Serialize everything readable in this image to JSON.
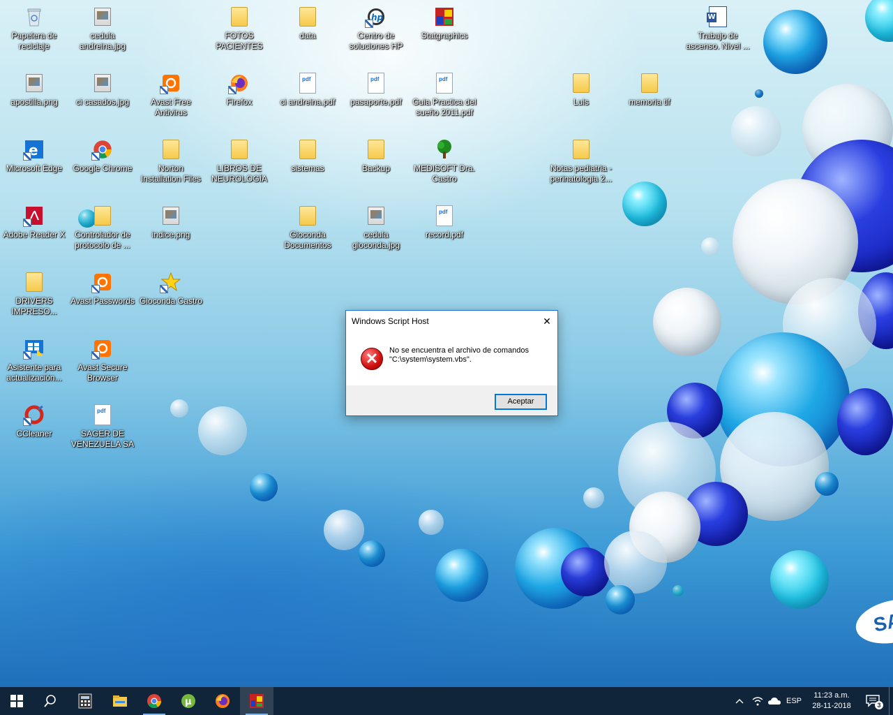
{
  "desktop": {
    "icons": [
      {
        "label": "Papelera de reciclaje",
        "icon": "recycle-bin-icon"
      },
      {
        "label": "cedula andreina.jpg",
        "icon": "image-file-icon"
      },
      {
        "label": "FOTOS PACIENTES",
        "icon": "folder-icon"
      },
      {
        "label": "data",
        "icon": "folder-icon"
      },
      {
        "label": "Centro de soluciones HP",
        "icon": "hp-icon"
      },
      {
        "label": "Statgraphics",
        "icon": "statgraphics-icon"
      },
      {
        "label": "Trabajo de ascenso. Nivel ...",
        "icon": "word-document-icon"
      },
      {
        "label": "apostilla.png",
        "icon": "image-file-icon"
      },
      {
        "label": "ci casados.jpg",
        "icon": "image-file-icon"
      },
      {
        "label": "Avast Free Antivirus",
        "icon": "avast-icon"
      },
      {
        "label": "Firefox",
        "icon": "firefox-icon"
      },
      {
        "label": "ci andreina.pdf",
        "icon": "pdf-file-icon"
      },
      {
        "label": "pasaporte.pdf",
        "icon": "pdf-file-icon"
      },
      {
        "label": "Guia Practica del sueño 2011.pdf",
        "icon": "pdf-file-icon"
      },
      {
        "label": "Luis",
        "icon": "folder-icon"
      },
      {
        "label": "memoria tlf",
        "icon": "folder-icon"
      },
      {
        "label": "Microsoft Edge",
        "icon": "edge-icon"
      },
      {
        "label": "Google Chrome",
        "icon": "chrome-icon"
      },
      {
        "label": "Norton Installation Files",
        "icon": "folder-icon"
      },
      {
        "label": "LIBROS DE NEUROLOGÍA",
        "icon": "folder-icon"
      },
      {
        "label": "sistemas",
        "icon": "folder-icon"
      },
      {
        "label": "Backup",
        "icon": "folder-icon"
      },
      {
        "label": "MEDISOFT Dra. Castro",
        "icon": "tree-icon"
      },
      {
        "label": "Notas pediatria - perinatologia 2...",
        "icon": "folder-icon"
      },
      {
        "label": "Adobe Reader X",
        "icon": "adobe-reader-icon"
      },
      {
        "label": "Controlador de protocolo de ...",
        "icon": "folder-icon"
      },
      {
        "label": "indice.png",
        "icon": "image-file-icon"
      },
      {
        "label": "Gioconda Documentos",
        "icon": "folder-icon"
      },
      {
        "label": "cedula gioconda.jpg",
        "icon": "image-file-icon"
      },
      {
        "label": "record.pdf",
        "icon": "pdf-file-icon"
      },
      {
        "label": "DRIVERS IMPRESO...",
        "icon": "folder-icon"
      },
      {
        "label": "Avast Passwords",
        "icon": "avast-passwords-icon"
      },
      {
        "label": "Gioconda Castro",
        "icon": "star-icon"
      },
      {
        "label": "Asistente para actualización...",
        "icon": "windows-update-icon"
      },
      {
        "label": "Avast Secure Browser",
        "icon": "avast-browser-icon"
      },
      {
        "label": "CCleaner",
        "icon": "ccleaner-icon"
      },
      {
        "label": "SAGER DE VENEZUELA SA",
        "icon": "pdf-file-icon"
      }
    ],
    "brand_fragment": "SA"
  },
  "dialog": {
    "title": "Windows Script Host",
    "message_line1": "No se encuentra el archivo de comandos",
    "message_line2": "\"C:\\system\\system.vbs\".",
    "button": "Aceptar",
    "close_glyph": "✕",
    "error_glyph": "✕"
  },
  "taskbar": {
    "apps": [
      {
        "name": "start-button",
        "icon": "windows-logo-icon"
      },
      {
        "name": "search-button",
        "icon": "search-icon"
      },
      {
        "name": "taskbar-calculator",
        "icon": "calculator-icon"
      },
      {
        "name": "taskbar-file-explorer",
        "icon": "file-explorer-icon"
      },
      {
        "name": "taskbar-chrome",
        "icon": "chrome-icon"
      },
      {
        "name": "taskbar-utorrent",
        "icon": "utorrent-icon"
      },
      {
        "name": "taskbar-firefox",
        "icon": "firefox-icon"
      },
      {
        "name": "taskbar-statgraphics",
        "icon": "statgraphics-icon"
      }
    ],
    "language": "ESP",
    "time": "11:23 a.m.",
    "date": "28-11-2018",
    "notification_count": "3"
  },
  "colors": {
    "taskbar_bg": "#10243a",
    "dialog_border": "#1b6fd2",
    "error_red": "#d01010",
    "accent": "#0078d7"
  }
}
